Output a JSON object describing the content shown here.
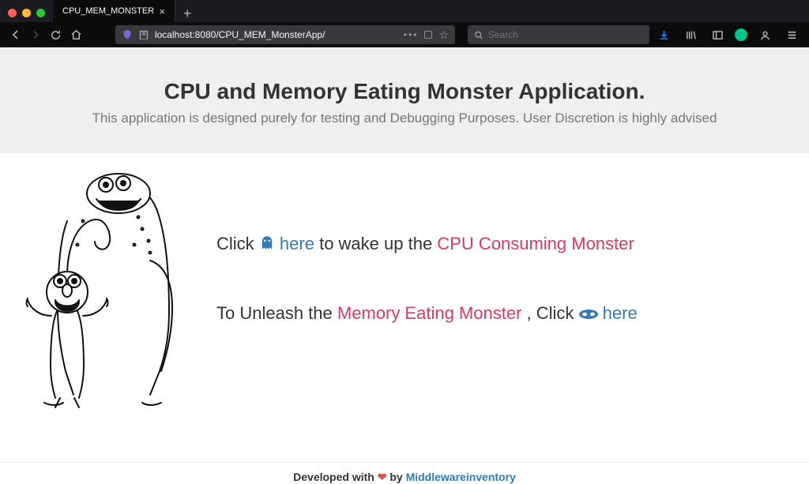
{
  "browser": {
    "tab_title": "CPU_MEM_MONSTER",
    "url": "localhost:8080/CPU_MEM_MonsterApp/",
    "search_placeholder": "Search"
  },
  "hero": {
    "title": "CPU and Memory Eating Monster Application.",
    "subtitle": "This application is designed purely for testing and Debugging Purposes. User Discretion is highly advised"
  },
  "actions": {
    "line1_pre": "Click ",
    "line1_link": "here",
    "line1_mid": " to wake up the ",
    "line1_danger": "CPU Consuming Monster",
    "line2_pre": "To Unleash the ",
    "line2_danger": "Memory Eating Monster",
    "line2_mid": ", Click ",
    "line2_link": "here"
  },
  "footer": {
    "pre": "Developed with ",
    "mid": " by ",
    "author": "Middlewareinventory"
  }
}
